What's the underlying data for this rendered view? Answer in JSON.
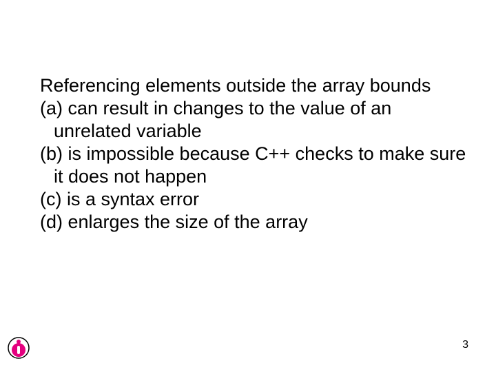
{
  "question": {
    "stem": "Referencing elements outside the array bounds",
    "options": {
      "a": "(a) can result in changes to the value of an unrelated variable",
      "b": "(b) is impossible because C++ checks to make sure it does not happen",
      "c": "(c) is a syntax error",
      "d": "(d) enlarges the size of the array"
    }
  },
  "page_number": "3"
}
